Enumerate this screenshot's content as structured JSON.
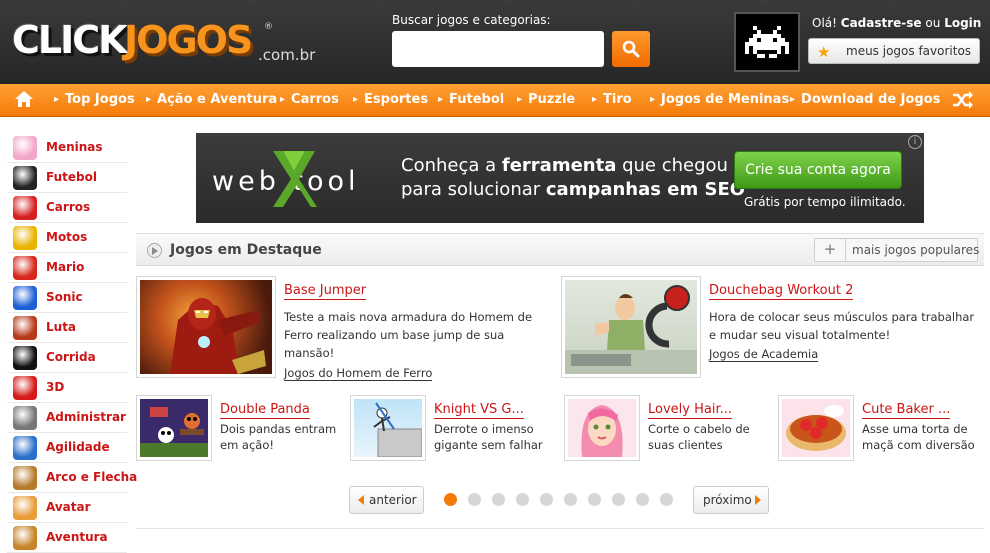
{
  "header": {
    "logo_click": "CLICK",
    "logo_jogos": "JOGOS",
    "logo_suffix": ".com.br",
    "logo_reg": "®",
    "search_label": "Buscar jogos e categorias:",
    "search_value": "",
    "greeting_prefix": "Olá!",
    "register_link": "Cadastre-se",
    "greeting_or": "ou",
    "login_link": "Login",
    "favorites_label": "meus jogos favoritos"
  },
  "nav": {
    "items": [
      {
        "label": "Top Jogos"
      },
      {
        "label": "Ação e Aventura"
      },
      {
        "label": "Carros"
      },
      {
        "label": "Esportes"
      },
      {
        "label": "Futebol"
      },
      {
        "label": "Puzzle"
      },
      {
        "label": "Tiro"
      },
      {
        "label": "Jogos de Meninas"
      },
      {
        "label": "Download de Jogos"
      }
    ]
  },
  "sidebar": {
    "items": [
      {
        "label": "Meninas",
        "icon": "girl-icon",
        "color": "#f2a6c8"
      },
      {
        "label": "Futebol",
        "icon": "soccer-ball-icon",
        "color": "#222222"
      },
      {
        "label": "Carros",
        "icon": "car-icon",
        "color": "#d62020"
      },
      {
        "label": "Motos",
        "icon": "motorcycle-icon",
        "color": "#e8b400"
      },
      {
        "label": "Mario",
        "icon": "mario-icon",
        "color": "#d8281c"
      },
      {
        "label": "Sonic",
        "icon": "sonic-icon",
        "color": "#1d5fd6"
      },
      {
        "label": "Luta",
        "icon": "fighter-icon",
        "color": "#b83a1a"
      },
      {
        "label": "Corrida",
        "icon": "checkered-flag-icon",
        "color": "#111111"
      },
      {
        "label": "3D",
        "icon": "cube-icon",
        "color": "#d61a1a"
      },
      {
        "label": "Administrar",
        "icon": "cash-register-icon",
        "color": "#777777"
      },
      {
        "label": "Agilidade",
        "icon": "cursor-icon",
        "color": "#2a6fc9"
      },
      {
        "label": "Arco e Flecha",
        "icon": "bow-arrow-icon",
        "color": "#b57b2a"
      },
      {
        "label": "Avatar",
        "icon": "avatar-icon",
        "color": "#e89c3a"
      },
      {
        "label": "Aventura",
        "icon": "adventure-icon",
        "color": "#c7852a"
      }
    ]
  },
  "banner": {
    "brand": "web tool",
    "line1_pre": "Conheça a ",
    "line1_bold": "ferramenta",
    "line1_post": " que chegou",
    "line2_pre": "para solucionar ",
    "line2_bold": "campanhas em SEO",
    "cta": "Crie sua conta agora",
    "sub": "Grátis por tempo ilimitado.",
    "info": "i"
  },
  "featured": {
    "title": "Jogos em Destaque",
    "more_label": "mais jogos populares",
    "more_plus": "+",
    "games": [
      {
        "title": "Base Jumper",
        "desc": "Teste a mais nova armadura do Homem de Ferro realizando um base jump de sua mansão!",
        "category": "Jogos do Homem de Ferro"
      },
      {
        "title": "Douchebag Workout 2",
        "desc": "Hora de colocar seus músculos para trabalhar e mudar seu visual totalmente!",
        "category": "Jogos de Academia"
      },
      {
        "title": "Double Panda",
        "desc": "Dois pandas entram em ação!"
      },
      {
        "title": "Knight VS G...",
        "desc": "Derrote o imenso gigante sem falhar"
      },
      {
        "title": "Lovely Hair...",
        "desc": "Corte o cabelo de suas clientes"
      },
      {
        "title": "Cute Baker ...",
        "desc": "Asse uma torta de maçã com diversão"
      }
    ]
  },
  "pager": {
    "prev": "anterior",
    "next": "próximo",
    "pages": 10,
    "active": 1
  },
  "colors": {
    "accent": "#f47b0a",
    "link_red": "#cc1515",
    "header_bg": "#2b2b2b"
  }
}
